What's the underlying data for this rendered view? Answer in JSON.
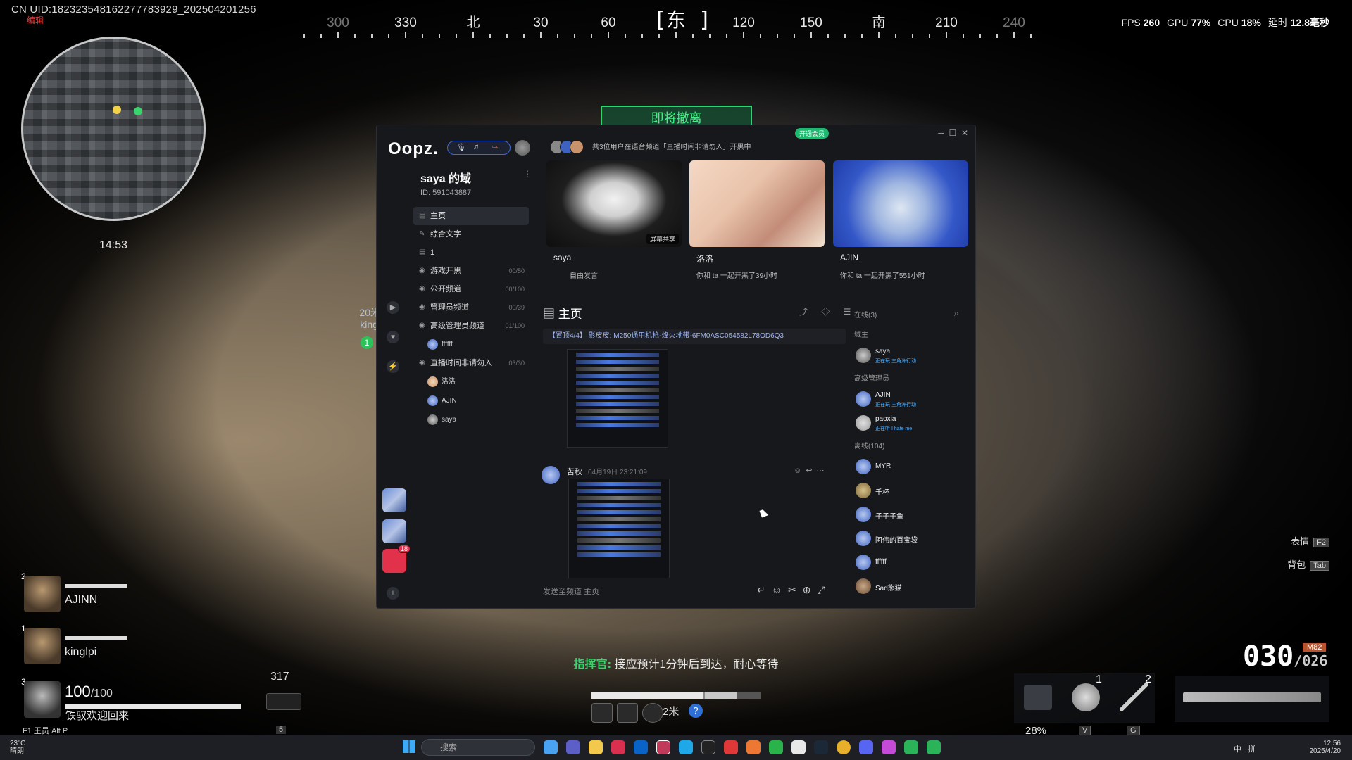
{
  "hud": {
    "uid": "CN UID:18232354816227778392­9_202504201256",
    "red_tag": "编辑",
    "compass": [
      "300",
      "330",
      "北",
      "30",
      "60",
      "东",
      "120",
      "150",
      "南",
      "210",
      "240"
    ],
    "fps_label": "FPS",
    "fps": "260",
    "gpu_label": "GPU",
    "gpu": "77%",
    "cpu_label": "CPU",
    "cpu": "18%",
    "latency_label": "延时",
    "latency": "12.8毫秒",
    "map_time": "14:53",
    "evac": "即将撤离",
    "ally_dist": "20米",
    "ally_name": "kingl",
    "ally_badge": "1",
    "team": [
      {
        "num": "2",
        "name": "AJINN"
      },
      {
        "num": "1",
        "name": "kinglpi"
      },
      {
        "num": "3",
        "name": ""
      }
    ],
    "hp": "100",
    "hp_max": "/100",
    "welcome": "铁驭欢迎回来",
    "ammo_reserve": "317",
    "commander_label": "指挥官:",
    "commander_msg": "接应预计1分钟后到达，耐心等待",
    "distance": "2米",
    "help": "?",
    "mag": "030",
    "mag_reserve": "/026",
    "mag_tag": "M82",
    "emote_label": "表情",
    "emote_key": "F2",
    "bag_label": "背包",
    "bag_key": "Tab",
    "slot1": "1",
    "slot2": "2",
    "pct": "28%",
    "key_v": "V",
    "key_g": "G",
    "bottom_keys": "F1 王员   Alt  P",
    "bottom_key5": "5"
  },
  "taskbar": {
    "temp": "23°C",
    "weather": "晴朗",
    "search_placeholder": "搜索",
    "time": "12:56",
    "date": "2025/4/20",
    "ime1": "中",
    "ime2": "拼"
  },
  "oopz": {
    "logo": "Oopz.",
    "vip": "开通会员",
    "server_name": "saya 的域",
    "server_id": "ID: 591043887",
    "server_badge": "18",
    "channels": [
      {
        "label": "主页",
        "icon": "▤",
        "count": "",
        "active": true
      },
      {
        "label": "综合文字",
        "icon": "✎",
        "count": ""
      },
      {
        "label": "1",
        "icon": "▤",
        "count": ""
      },
      {
        "label": "游戏开黑",
        "icon": "◉",
        "count": "00/50"
      },
      {
        "label": "公开频道",
        "icon": "◉",
        "count": "00/100"
      },
      {
        "label": "管理员频道",
        "icon": "◉",
        "count": "00/39"
      },
      {
        "label": "高级管理员频道",
        "icon": "◉",
        "count": "01/100"
      }
    ],
    "sub1": "ffffff",
    "channel_live": "直播时间非请勿入",
    "channel_live_count": "03/30",
    "voice_users": [
      "洛洛",
      "AJIN",
      "saya"
    ],
    "voice_header": "共3位用户在语音频道「直播时间非请勿入」开黑中",
    "cards": [
      {
        "name": "saya",
        "sub": "自由发言",
        "share": "屏幕共享"
      },
      {
        "name": "洛洛",
        "sub": "你和 ta 一起开黑了39小时"
      },
      {
        "name": "AJIN",
        "sub": "你和 ta 一起开黑了551小时"
      }
    ],
    "chat_title": "主页",
    "pinned": "【置顶4/4】 影皮皮:  M250通用机枪-烽火地带-6FM0ASC054582L78OD6Q3",
    "msg_author": "苦秋",
    "msg_time": "04月19日 23:21:09",
    "input_placeholder": "发送至频道 主页",
    "online_header": "在线(3)",
    "role_owner": "域主",
    "role_admin": "高级管理员",
    "offline_header": "离线(104)",
    "online": [
      {
        "name": "saya",
        "status": "正在玩 三角洲行动"
      },
      {
        "name": "AJIN",
        "status": "正在玩 三角洲行动"
      },
      {
        "name": "paoxia",
        "status": "正在听 I hate me"
      }
    ],
    "offline": [
      "MYR",
      "千杯",
      "子子子鱼",
      "阿伟的百宝袋",
      "ffffff",
      "Sad熊猫"
    ]
  }
}
